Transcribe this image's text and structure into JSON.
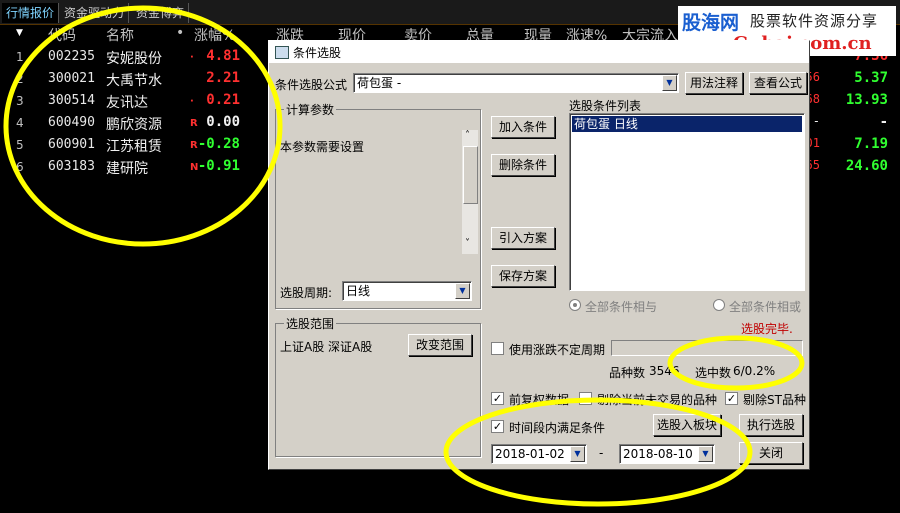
{
  "tabs": [
    {
      "label": "行情报价",
      "active": true
    },
    {
      "label": "资金驱动力",
      "active": false
    },
    {
      "label": "资金博弈",
      "active": false
    }
  ],
  "quote_header": {
    "sort_arrow": "▼",
    "code": "代码",
    "name": "名称",
    "dot": "•",
    "change_pct": "涨幅%",
    "change": "涨跌",
    "price": "现价",
    "sell": "卖价",
    "volume": "总量",
    "current_vol": "现量",
    "speed": "涨速%",
    "big_order": "大宗流入"
  },
  "quote_rows": [
    {
      "idx": "1",
      "code": "002235",
      "name": "安妮股份",
      "flag": "·",
      "flag_color": "#ff3030",
      "change_pct": "4.81",
      "chg_color": "#ff3030",
      "r1": "",
      "r1_color": "#ff3030",
      "r2": "7.36",
      "r2_color": "#ff3030"
    },
    {
      "idx": "2",
      "code": "300021",
      "name": "大禹节水",
      "flag": "",
      "flag_color": "#ff3030",
      "change_pct": "2.21",
      "chg_color": "#ff3030",
      "r1": "56",
      "r1_color": "#ff3030",
      "r2": "5.37",
      "r2_color": "#30ff30"
    },
    {
      "idx": "3",
      "code": "300514",
      "name": "友讯达",
      "flag": "·",
      "flag_color": "#ff3030",
      "change_pct": "0.21",
      "chg_color": "#ff3030",
      "r1": "68",
      "r1_color": "#ff3030",
      "r2": "13.93",
      "r2_color": "#30ff30"
    },
    {
      "idx": "4",
      "code": "600490",
      "name": "鹏欣资源",
      "flag": "R",
      "flag_color": "#ff3030",
      "change_pct": "0.00",
      "chg_color": "#f0f0f0",
      "r1": "-",
      "r1_color": "#f0f0f0",
      "r2": "-",
      "r2_color": "#f0f0f0"
    },
    {
      "idx": "5",
      "code": "600901",
      "name": "江苏租赁",
      "flag": "R",
      "flag_color": "#ff3030",
      "change_pct": "-0.28",
      "chg_color": "#30ff30",
      "r1": "01",
      "r1_color": "#ff3030",
      "r2": "7.19",
      "r2_color": "#30ff30"
    },
    {
      "idx": "6",
      "code": "603183",
      "name": "建研院",
      "flag": "N",
      "flag_color": "#ff3030",
      "change_pct": "-0.91",
      "chg_color": "#30ff30",
      "r1": "65",
      "r1_color": "#ff3030",
      "r2": "24.60",
      "r2_color": "#30ff30"
    }
  ],
  "dialog": {
    "title": "条件选股",
    "formula_label": "条件选股公式",
    "formula_value": "荷包蛋          -",
    "btn_usage": "用法注释",
    "btn_view_formula": "查看公式",
    "calc_params_title": "计算参数",
    "calc_params_text": "本参数需要设置",
    "period_label": "选股周期:",
    "period_value": "日线",
    "btn_add": "加入条件",
    "btn_delete": "删除条件",
    "btn_import": "引入方案",
    "btn_save": "保存方案",
    "cond_list_title": "选股条件列表",
    "cond_list_items": [
      "荷包蛋  日线"
    ],
    "radio_and": "全部条件相与",
    "radio_or": "全部条件相或",
    "status": "选股完毕.",
    "scope_title": "选股范围",
    "scope_text": "上证A股  深证A股",
    "btn_change_scope": "改变范围",
    "use_variable_period": "使用涨跌不定周期",
    "count_label": "品种数",
    "count_value": "3546",
    "selected_label": "选中数",
    "selected_value": "6/0.2%",
    "forward_adjust": "前复权数据",
    "exclude_untraded": "剔除当前未交易的品种",
    "exclude_st": "剔除ST品种",
    "time_range_label": "时间段内满足条件",
    "btn_to_block": "选股入板块",
    "btn_execute": "执行选股",
    "date_from": "2018-01-02",
    "date_sep": "-",
    "date_to": "2018-08-10",
    "btn_close": "关闭"
  },
  "watermark": {
    "brand": "股海网",
    "slogan": "股票软件资源分享",
    "url": "www.Guhai.com.cn"
  },
  "annotation_color": "#ffff00"
}
